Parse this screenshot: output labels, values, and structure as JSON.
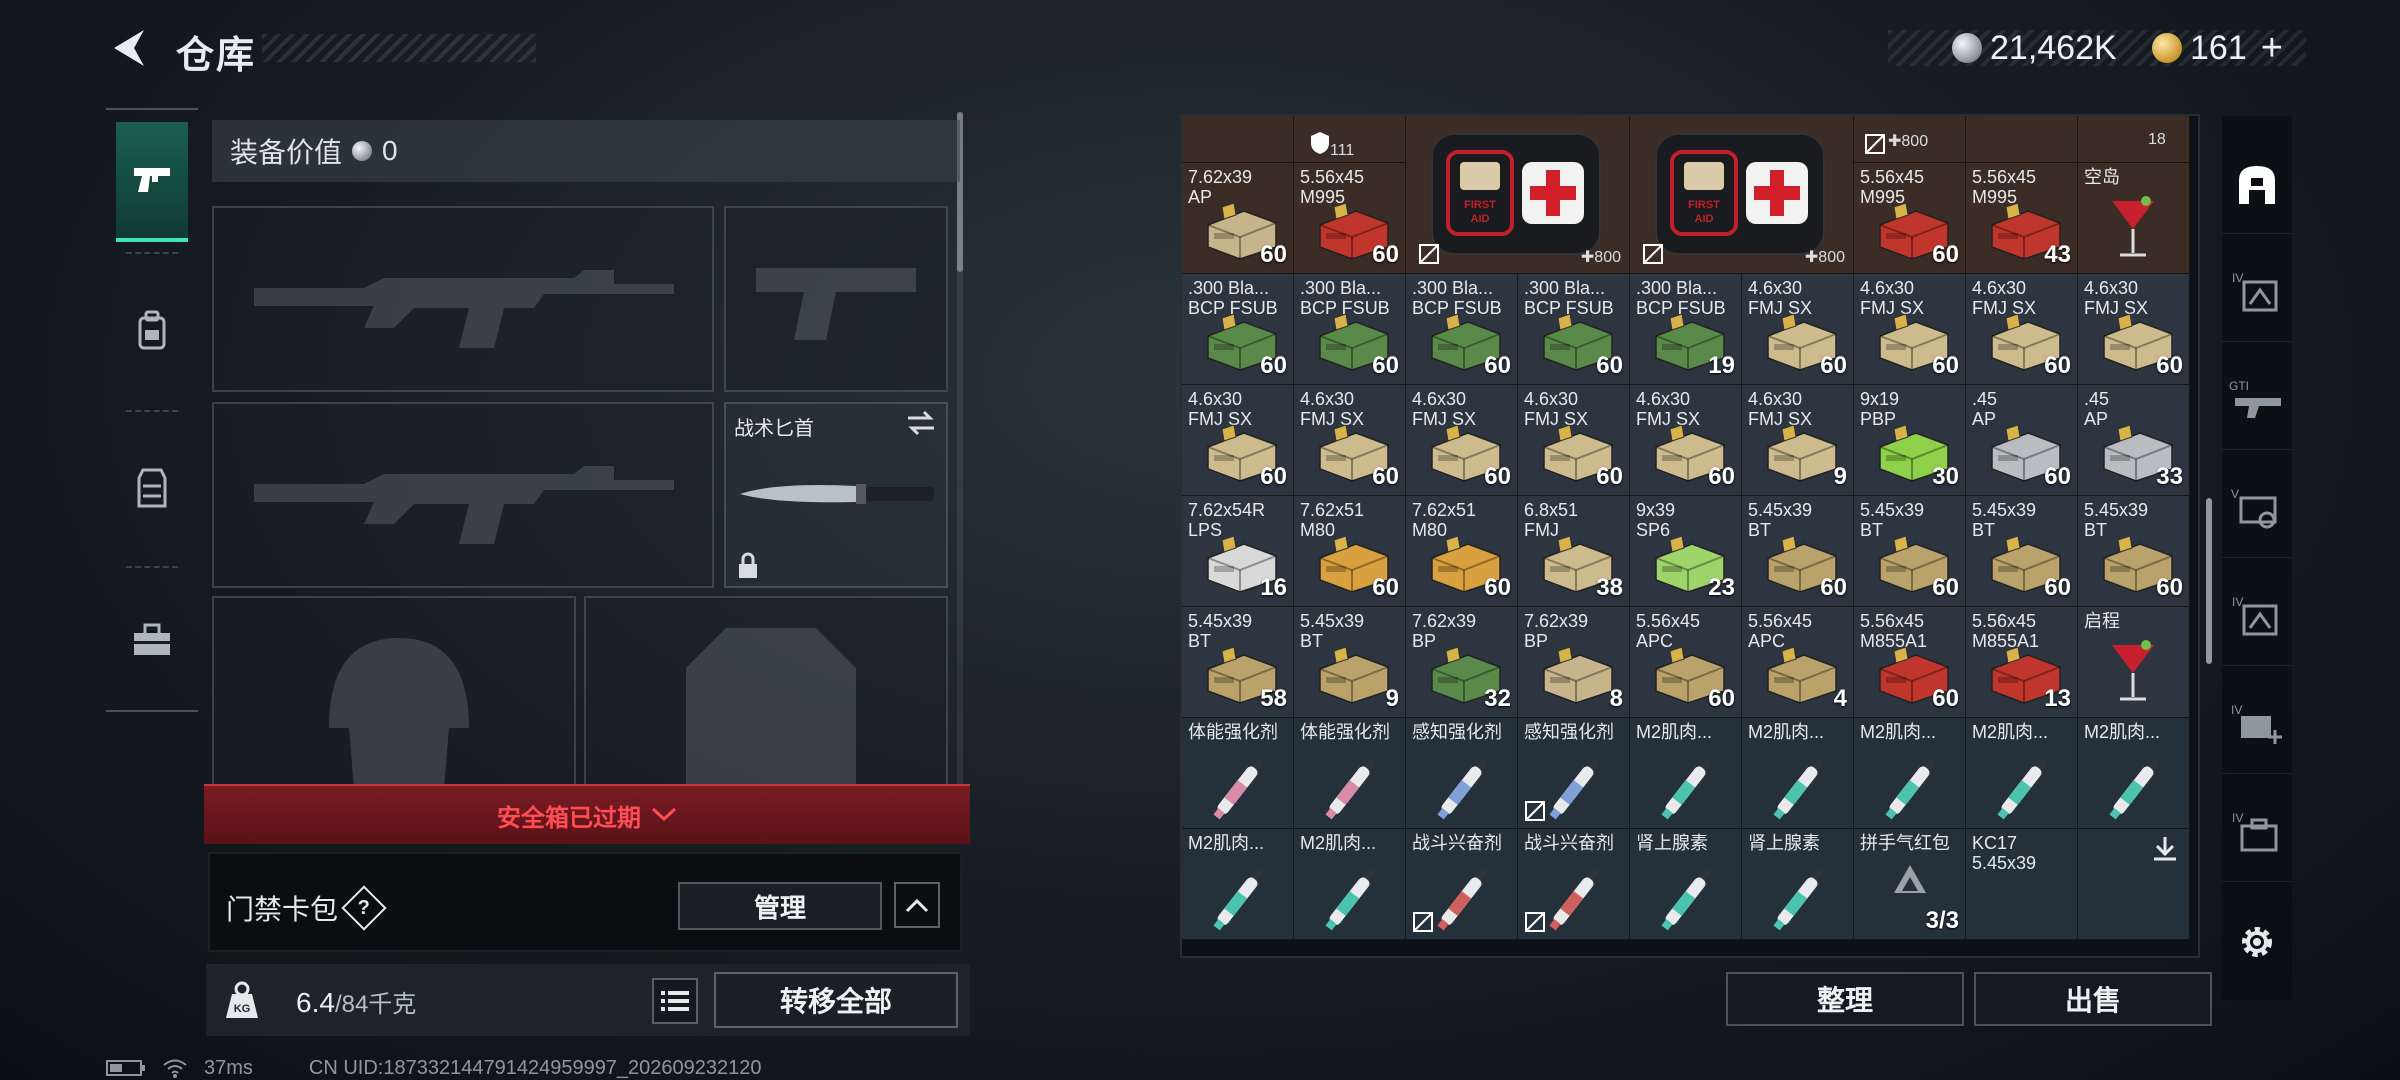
{
  "header": {
    "title": "仓库",
    "currencies": [
      {
        "icon": "silver-coin-icon",
        "value": "21,462K"
      },
      {
        "icon": "gold-coin-icon",
        "value": "161"
      }
    ],
    "add_label": "+"
  },
  "left_nav": {
    "tabs": [
      {
        "icon": "pistol-icon",
        "active": true
      },
      {
        "icon": "backpack-icon",
        "active": false
      },
      {
        "icon": "vest-icon",
        "active": false
      },
      {
        "icon": "toolbox-icon",
        "active": false
      }
    ]
  },
  "equipment": {
    "value_label": "装备价值",
    "value": "0",
    "knife_label": "战术匕首",
    "expired_label": "安全箱已过期",
    "keycard_label": "门禁卡包",
    "keycard_help": "?",
    "manage_label": "管理",
    "weight_value": "6.4",
    "weight_max": "/84千克",
    "transfer_all_label": "转移全部"
  },
  "status_bar": {
    "ping": "37ms",
    "uid": "CN UID:18733214479142495999­7_202609232120"
  },
  "stash": {
    "sort_label": "整理",
    "sell_label": "出售",
    "top_row": [
      {
        "stat": "111",
        "icon": "armor-icon"
      },
      {
        "stat": "800",
        "icon": "plus-icon"
      },
      {
        "count": "18"
      }
    ],
    "medkits": [
      {
        "art_text": "FIRST AID",
        "stat": "800"
      },
      {
        "art_text": "FIRST AID",
        "stat": "800"
      }
    ],
    "rows": [
      [
        {
          "n1": "7.62x39",
          "n2": "AP",
          "count": "60",
          "color": "#c8b48a"
        },
        {
          "n1": "5.56x45",
          "n2": "M995",
          "count": "60",
          "color": "#c0362c"
        },
        null,
        null,
        null,
        null,
        {
          "n1": "5.56x45",
          "n2": "M995",
          "count": "60",
          "color": "#c0362c"
        },
        {
          "n1": "5.56x45",
          "n2": "M995",
          "count": "43",
          "color": "#c0362c"
        },
        {
          "n1": "空岛",
          "n2": "",
          "count": "",
          "color": "drink"
        }
      ],
      [
        {
          "n1": ".300 Bla...",
          "n2": "BCP FSUB",
          "count": "60",
          "color": "#5a8a4a"
        },
        {
          "n1": ".300 Bla...",
          "n2": "BCP FSUB",
          "count": "60",
          "color": "#5a8a4a"
        },
        {
          "n1": ".300 Bla...",
          "n2": "BCP FSUB",
          "count": "60",
          "color": "#5a8a4a"
        },
        {
          "n1": ".300 Bla...",
          "n2": "BCP FSUB",
          "count": "60",
          "color": "#5a8a4a"
        },
        {
          "n1": ".300 Bla...",
          "n2": "BCP FSUB",
          "count": "19",
          "color": "#5a8a4a"
        },
        {
          "n1": "4.6x30",
          "n2": "FMJ SX",
          "count": "60",
          "color": "#cdbb8e"
        },
        {
          "n1": "4.6x30",
          "n2": "FMJ SX",
          "count": "60",
          "color": "#cdbb8e"
        },
        {
          "n1": "4.6x30",
          "n2": "FMJ SX",
          "count": "60",
          "color": "#cdbb8e"
        },
        {
          "n1": "4.6x30",
          "n2": "FMJ SX",
          "count": "60",
          "color": "#cdbb8e"
        }
      ],
      [
        {
          "n1": "4.6x30",
          "n2": "FMJ SX",
          "count": "60",
          "color": "#cdbb8e"
        },
        {
          "n1": "4.6x30",
          "n2": "FMJ SX",
          "count": "60",
          "color": "#cdbb8e"
        },
        {
          "n1": "4.6x30",
          "n2": "FMJ SX",
          "count": "60",
          "color": "#cdbb8e"
        },
        {
          "n1": "4.6x30",
          "n2": "FMJ SX",
          "count": "60",
          "color": "#cdbb8e"
        },
        {
          "n1": "4.6x30",
          "n2": "FMJ SX",
          "count": "60",
          "color": "#cdbb8e"
        },
        {
          "n1": "4.6x30",
          "n2": "FMJ SX",
          "count": "9",
          "color": "#cdbb8e"
        },
        {
          "n1": "9x19",
          "n2": "PBP",
          "count": "30",
          "color": "#8fd04a"
        },
        {
          "n1": ".45",
          "n2": "AP",
          "count": "60",
          "color": "#b9bcc0"
        },
        {
          "n1": ".45",
          "n2": "AP",
          "count": "33",
          "color": "#b9bcc0"
        }
      ],
      [
        {
          "n1": "7.62x54R",
          "n2": "LPS",
          "count": "16",
          "color": "#d9d9d9"
        },
        {
          "n1": "7.62x51",
          "n2": "M80",
          "count": "60",
          "color": "#d9a040"
        },
        {
          "n1": "7.62x51",
          "n2": "M80",
          "count": "60",
          "color": "#d9a040"
        },
        {
          "n1": "6.8x51",
          "n2": "FMJ",
          "count": "38",
          "color": "#cdbb8e"
        },
        {
          "n1": "9x39",
          "n2": "SP6",
          "count": "23",
          "color": "#9fd46a"
        },
        {
          "n1": "5.45x39",
          "n2": "BT",
          "count": "60",
          "color": "#b9a36a"
        },
        {
          "n1": "5.45x39",
          "n2": "BT",
          "count": "60",
          "color": "#b9a36a"
        },
        {
          "n1": "5.45x39",
          "n2": "BT",
          "count": "60",
          "color": "#b9a36a"
        },
        {
          "n1": "5.45x39",
          "n2": "BT",
          "count": "60",
          "color": "#b9a36a"
        }
      ],
      [
        {
          "n1": "5.45x39",
          "n2": "BT",
          "count": "58",
          "color": "#b9a36a"
        },
        {
          "n1": "5.45x39",
          "n2": "BT",
          "count": "9",
          "color": "#b9a36a"
        },
        {
          "n1": "7.62x39",
          "n2": "BP",
          "count": "32",
          "color": "#5a8a4a"
        },
        {
          "n1": "7.62x39",
          "n2": "BP",
          "count": "8",
          "color": "#c8b48a"
        },
        {
          "n1": "5.56x45",
          "n2": "APC",
          "count": "60",
          "color": "#b9a36a"
        },
        {
          "n1": "5.56x45",
          "n2": "APC",
          "count": "4",
          "color": "#b9a36a"
        },
        {
          "n1": "5.56x45",
          "n2": "M855A1",
          "count": "60",
          "color": "#c0362c"
        },
        {
          "n1": "5.56x45",
          "n2": "M855A1",
          "count": "13",
          "color": "#c0362c"
        },
        {
          "n1": "启程",
          "n2": "",
          "count": "",
          "color": "drink"
        }
      ],
      [
        {
          "n1": "体能强化剂",
          "count": "",
          "color": "inj-pink"
        },
        {
          "n1": "体能强化剂",
          "count": "",
          "color": "inj-pink"
        },
        {
          "n1": "感知强化剂",
          "count": "",
          "color": "inj-blue"
        },
        {
          "n1": "感知强化剂",
          "count": "",
          "color": "inj-blue",
          "noicon": true
        },
        {
          "n1": "M2肌肉...",
          "count": "",
          "color": "inj-teal"
        },
        {
          "n1": "M2肌肉...",
          "count": "",
          "color": "inj-teal"
        },
        {
          "n1": "M2肌肉...",
          "count": "",
          "color": "inj-teal"
        },
        {
          "n1": "M2肌肉...",
          "count": "",
          "color": "inj-teal"
        },
        {
          "n1": "M2肌肉...",
          "count": "",
          "color": "inj-teal"
        }
      ],
      [
        {
          "n1": "M2肌肉...",
          "count": "",
          "color": "inj-teal"
        },
        {
          "n1": "M2肌肉...",
          "count": "",
          "color": "inj-teal"
        },
        {
          "n1": "战斗兴奋剂",
          "count": "",
          "color": "inj-red",
          "noicon": true
        },
        {
          "n1": "战斗兴奋剂",
          "count": "",
          "color": "inj-red",
          "noicon": true
        },
        {
          "n1": "肾上腺素",
          "count": "",
          "color": "inj-teal"
        },
        {
          "n1": "肾上腺素",
          "count": "",
          "color": "inj-teal"
        },
        {
          "n1": "拼手气红包",
          "count": "3/3",
          "color": "mystery"
        },
        {
          "n1": "KC17",
          "n2": "5.45x39",
          "count": "",
          "color": "empty"
        },
        {
          "n1": "",
          "count": "",
          "color": "download"
        }
      ]
    ]
  },
  "right_nav": {
    "items": [
      {
        "icon": "stash-icon",
        "active": true
      },
      {
        "icon": "tier4-gear-icon"
      },
      {
        "icon": "gti-gun-icon"
      },
      {
        "icon": "tier5-key-icon"
      },
      {
        "icon": "tier4-chip-icon"
      },
      {
        "icon": "tier4-add-icon"
      },
      {
        "icon": "tier4-case-icon"
      }
    ],
    "settings_icon": "gear-icon"
  },
  "colors": {
    "accent_green": "#3ee6b0",
    "expired_red": "#ff4d55",
    "stash_warm": "#3b2c25",
    "stash_cool": "#2c3540"
  }
}
